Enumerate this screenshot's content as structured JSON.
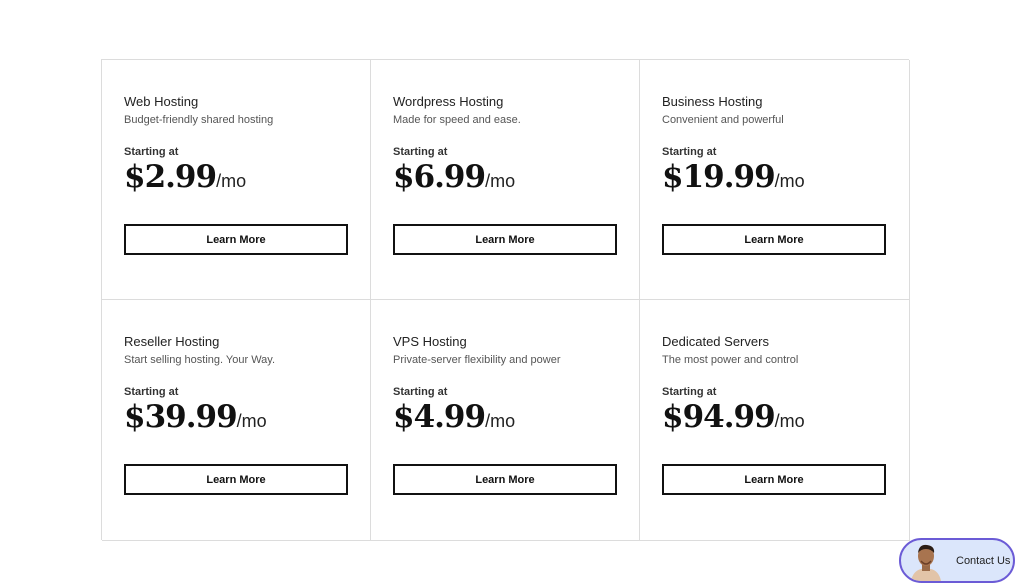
{
  "plans": [
    {
      "name": "Web Hosting",
      "tagline": "Budget-friendly shared hosting",
      "starting_label": "Starting at",
      "price": "$2.99",
      "period": "/mo",
      "cta": "Learn More"
    },
    {
      "name": "Wordpress Hosting",
      "tagline": "Made for speed and ease.",
      "starting_label": "Starting at",
      "price": "$6.99",
      "period": "/mo",
      "cta": "Learn More"
    },
    {
      "name": "Business Hosting",
      "tagline": "Convenient and powerful",
      "starting_label": "Starting at",
      "price": "$19.99",
      "period": "/mo",
      "cta": "Learn More"
    },
    {
      "name": "Reseller Hosting",
      "tagline": "Start selling hosting. Your Way.",
      "starting_label": "Starting at",
      "price": "$39.99",
      "period": "/mo",
      "cta": "Learn More"
    },
    {
      "name": "VPS Hosting",
      "tagline": "Private-server flexibility and power",
      "starting_label": "Starting at",
      "price": "$4.99",
      "period": "/mo",
      "cta": "Learn More"
    },
    {
      "name": "Dedicated Servers",
      "tagline": "The most power and control",
      "starting_label": "Starting at",
      "price": "$94.99",
      "period": "/mo",
      "cta": "Learn More"
    }
  ],
  "contact": {
    "label": "Contact Us",
    "avatar_icon": "support-agent-avatar"
  },
  "colors": {
    "border": "#dcdcdc",
    "button_border": "#111111",
    "contact_bg": "#dbe6fb",
    "contact_border": "#6b5bd6"
  }
}
